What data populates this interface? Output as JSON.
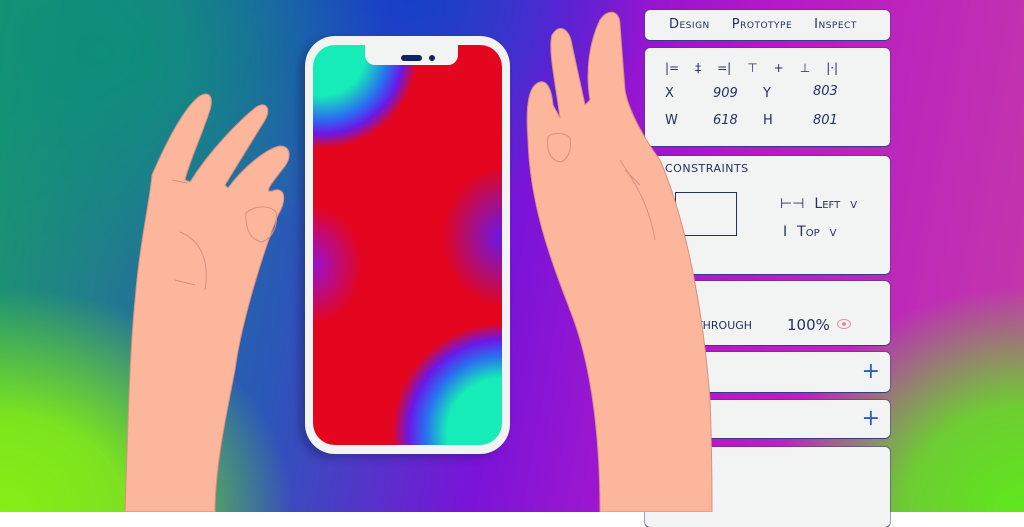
{
  "tabs": [
    "Design",
    "Prototype",
    "Inspect"
  ],
  "align_icons": [
    "align-left-icon",
    "align-horizontal-center-icon",
    "align-right-icon",
    "align-top-icon",
    "align-vertical-center-icon",
    "align-bottom-icon",
    "distribute-icon"
  ],
  "align_glyphs": [
    "|=",
    "‡",
    "=|",
    "⊤",
    "+",
    "⊥",
    "|·|"
  ],
  "position": {
    "x_label": "X",
    "x_value": "909",
    "y_label": "Y",
    "y_value": "803",
    "w_label": "W",
    "w_value": "618",
    "h_label": "H",
    "h_value": "801"
  },
  "constraints": {
    "title": "CONSTRAINTS",
    "horizontal": "Left",
    "vertical": "Top",
    "chevron": "v"
  },
  "layer": {
    "blend_label": "PASS THROUGH",
    "opacity": "100%"
  },
  "fill_plus": "+",
  "stroke_plus": "+",
  "colors": {
    "panel_bg": "#f2f4f3",
    "text": "#243060",
    "screen_red": "#e4061e",
    "screen_teal": "#15ecb8",
    "skin": "#fbb69c",
    "accent_blue": "#2a60b8",
    "eye_pink": "#e88a9a"
  }
}
